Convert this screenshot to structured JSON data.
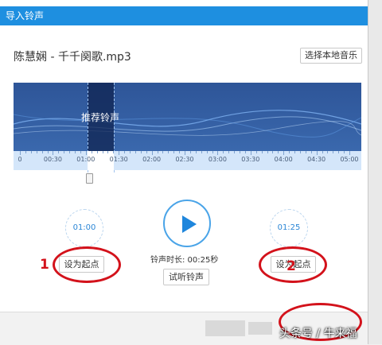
{
  "dialog": {
    "title": "导入铃声",
    "song_title": "陈慧娴 - 千千阕歌.mp3",
    "choose_local_label": "选择本地音乐"
  },
  "waveform": {
    "recommend_label": "推荐铃声",
    "ruler_labels": [
      "0",
      "00:30",
      "01:00",
      "01:30",
      "02:00",
      "02:30",
      "03:00",
      "03:30",
      "04:00",
      "04:30",
      "05:00"
    ],
    "colors": {
      "accent": "#1e8fe0",
      "wave_bg": "#2e5598",
      "ruler_bg": "#d4e6fa",
      "annotation": "#d3121b"
    }
  },
  "controls": {
    "start_time": "01:00",
    "end_time": "01:25",
    "set_start_label": "设为起点",
    "set_end_label": "设为起点",
    "duration_text": "铃声时长: 00:25秒",
    "try_listen_label": "试听铃声",
    "play_icon": "play-icon"
  },
  "annotations": {
    "num_1": "1",
    "num_2": "2"
  },
  "watermark": "头条号 / 牛来福"
}
